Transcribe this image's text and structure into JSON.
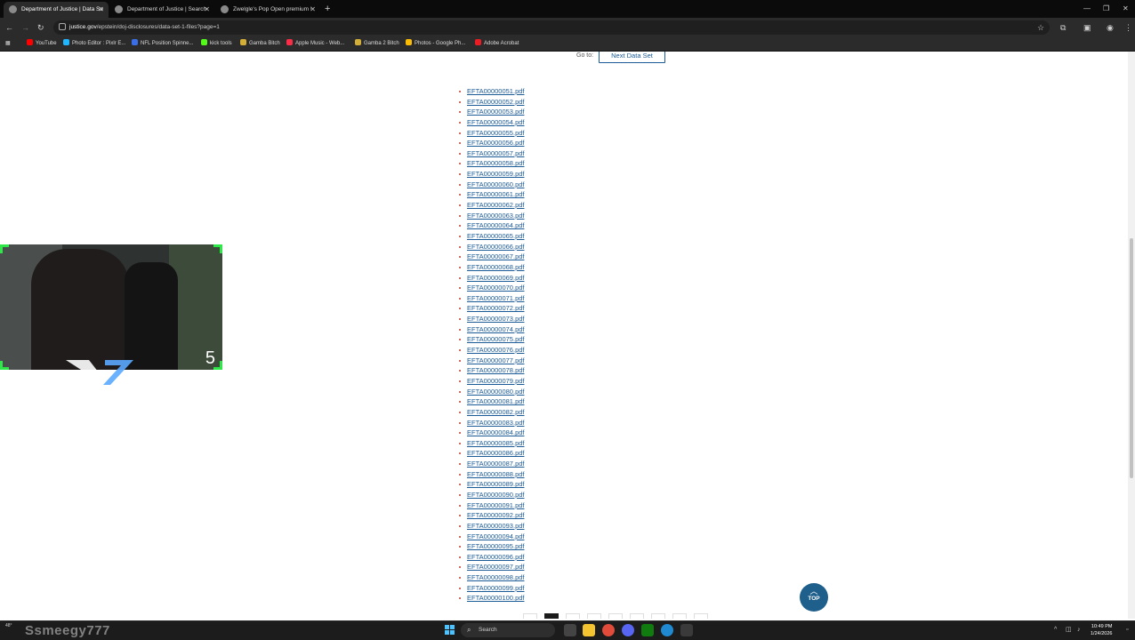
{
  "browser": {
    "tabs": [
      {
        "title": "Department of Justice | Data Se",
        "active": true
      },
      {
        "title": "Department of Justice | Search",
        "active": false
      },
      {
        "title": "Zwelgle's Pop Open premium !",
        "active": false
      }
    ],
    "address": {
      "host": "justice.gov",
      "path": "/epstein/doj-disclosures/data-set-1-files?page=1"
    },
    "bookmarks": [
      {
        "label": "YouTube",
        "color": "#ff0000"
      },
      {
        "label": "Photo Editor : Pixlr E...",
        "color": "#1fb6ff"
      },
      {
        "label": "NFL Position Spinne...",
        "color": "#3a6ee8"
      },
      {
        "label": "kick tools",
        "color": "#53fc18"
      },
      {
        "label": "Gamba Bitch",
        "color": "#d4af37"
      },
      {
        "label": "Apple Music - Web...",
        "color": "#fa2d48"
      },
      {
        "label": "Gamba 2 Bitch",
        "color": "#d4af37"
      },
      {
        "label": "Photos - Google Ph...",
        "color": "#fbbc05"
      },
      {
        "label": "Adobe Acrobat",
        "color": "#ec1c24"
      }
    ]
  },
  "page": {
    "goto_label": "Go to:",
    "next_button": "Next Data Set",
    "files": [
      "EFTA00000051.pdf",
      "EFTA00000052.pdf",
      "EFTA00000053.pdf",
      "EFTA00000054.pdf",
      "EFTA00000055.pdf",
      "EFTA00000056.pdf",
      "EFTA00000057.pdf",
      "EFTA00000058.pdf",
      "EFTA00000059.pdf",
      "EFTA00000060.pdf",
      "EFTA00000061.pdf",
      "EFTA00000062.pdf",
      "EFTA00000063.pdf",
      "EFTA00000064.pdf",
      "EFTA00000065.pdf",
      "EFTA00000066.pdf",
      "EFTA00000067.pdf",
      "EFTA00000068.pdf",
      "EFTA00000069.pdf",
      "EFTA00000070.pdf",
      "EFTA00000071.pdf",
      "EFTA00000072.pdf",
      "EFTA00000073.pdf",
      "EFTA00000074.pdf",
      "EFTA00000075.pdf",
      "EFTA00000076.pdf",
      "EFTA00000077.pdf",
      "EFTA00000078.pdf",
      "EFTA00000079.pdf",
      "EFTA00000080.pdf",
      "EFTA00000081.pdf",
      "EFTA00000082.pdf",
      "EFTA00000083.pdf",
      "EFTA00000084.pdf",
      "EFTA00000085.pdf",
      "EFTA00000086.pdf",
      "EFTA00000087.pdf",
      "EFTA00000088.pdf",
      "EFTA00000089.pdf",
      "EFTA00000090.pdf",
      "EFTA00000091.pdf",
      "EFTA00000092.pdf",
      "EFTA00000093.pdf",
      "EFTA00000094.pdf",
      "EFTA00000095.pdf",
      "EFTA00000096.pdf",
      "EFTA00000097.pdf",
      "EFTA00000098.pdf",
      "EFTA00000099.pdf",
      "EFTA00000100.pdf"
    ],
    "top_button": "TOP",
    "link_color": "#1a5a96",
    "accent_color": "#1f5f8b"
  },
  "overlay": {
    "cam_number": "5",
    "watermark": "Ssmeegy777",
    "frame_color": "#2ee84a"
  },
  "taskbar": {
    "weather": "48°",
    "search_placeholder": "Search",
    "time": "10:49 PM",
    "date": "1/24/2026"
  }
}
